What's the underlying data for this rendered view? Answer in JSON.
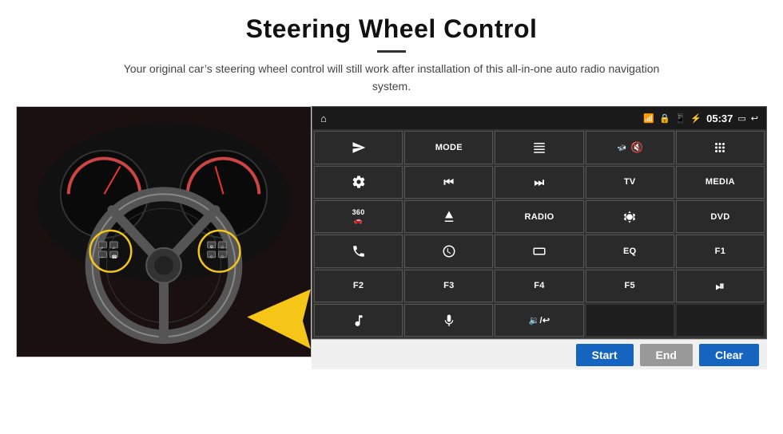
{
  "header": {
    "title": "Steering Wheel Control",
    "divider": true,
    "subtitle": "Your original car’s steering wheel control will still work after installation of this all-in-one auto radio navigation system."
  },
  "status_bar": {
    "home_icon": "home",
    "wifi_icon": "wifi",
    "lock_icon": "lock",
    "sd_icon": "sd",
    "bt_icon": "bluetooth",
    "time": "05:37",
    "screen_icon": "screen",
    "back_icon": "back"
  },
  "buttons": [
    {
      "id": "row1",
      "cells": [
        {
          "type": "icon",
          "icon": "send",
          "label": ""
        },
        {
          "type": "text",
          "label": "MODE"
        },
        {
          "type": "icon",
          "icon": "list",
          "label": ""
        },
        {
          "type": "icon",
          "icon": "mute",
          "label": ""
        },
        {
          "type": "icon",
          "icon": "apps",
          "label": ""
        }
      ]
    },
    {
      "id": "row2",
      "cells": [
        {
          "type": "icon",
          "icon": "settings",
          "label": ""
        },
        {
          "type": "icon",
          "icon": "prev",
          "label": ""
        },
        {
          "type": "icon",
          "icon": "next",
          "label": ""
        },
        {
          "type": "text",
          "label": "TV"
        },
        {
          "type": "text",
          "label": "MEDIA"
        }
      ]
    },
    {
      "id": "row3",
      "cells": [
        {
          "type": "icon",
          "icon": "360cam",
          "label": ""
        },
        {
          "type": "icon",
          "icon": "eject",
          "label": ""
        },
        {
          "type": "text",
          "label": "RADIO"
        },
        {
          "type": "icon",
          "icon": "brightness",
          "label": ""
        },
        {
          "type": "text",
          "label": "DVD"
        }
      ]
    },
    {
      "id": "row4",
      "cells": [
        {
          "type": "icon",
          "icon": "phone",
          "label": ""
        },
        {
          "type": "icon",
          "icon": "swirl",
          "label": ""
        },
        {
          "type": "icon",
          "icon": "screen-rect",
          "label": ""
        },
        {
          "type": "text",
          "label": "EQ"
        },
        {
          "type": "text",
          "label": "F1"
        }
      ]
    },
    {
      "id": "row5",
      "cells": [
        {
          "type": "text",
          "label": "F2"
        },
        {
          "type": "text",
          "label": "F3"
        },
        {
          "type": "text",
          "label": "F4"
        },
        {
          "type": "text",
          "label": "F5"
        },
        {
          "type": "icon",
          "icon": "play-pause",
          "label": ""
        }
      ]
    },
    {
      "id": "row6",
      "cells": [
        {
          "type": "icon",
          "icon": "music",
          "label": ""
        },
        {
          "type": "icon",
          "icon": "mic",
          "label": ""
        },
        {
          "type": "icon",
          "icon": "vol-call",
          "label": ""
        },
        {
          "type": "empty",
          "label": ""
        },
        {
          "type": "empty",
          "label": ""
        }
      ]
    }
  ],
  "bottom_buttons": {
    "start_label": "Start",
    "end_label": "End",
    "clear_label": "Clear"
  }
}
